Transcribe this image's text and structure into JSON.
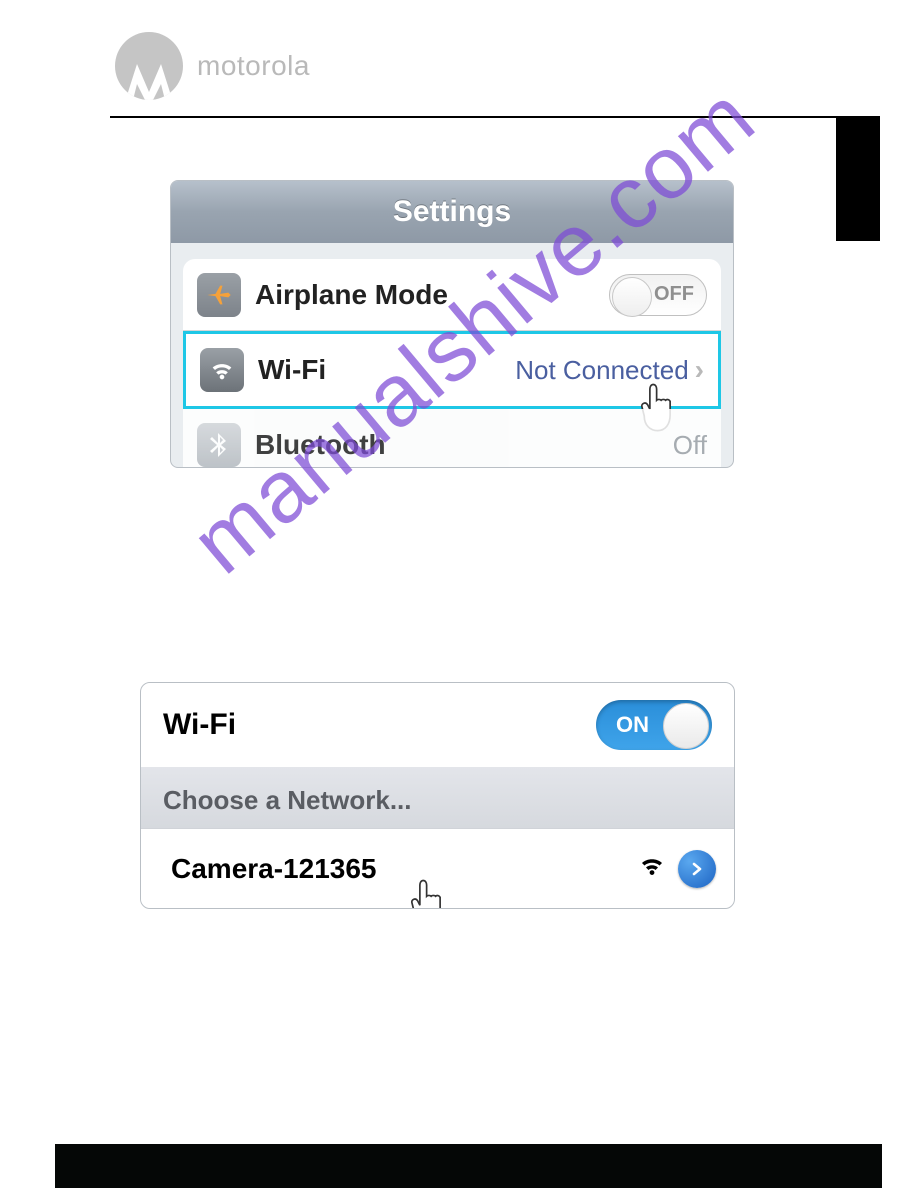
{
  "brand": {
    "name": "motorola"
  },
  "watermark": {
    "text": "manualshive.com"
  },
  "settings": {
    "title": "Settings",
    "rows": {
      "airplane": {
        "label": "Airplane Mode",
        "toggle_text": "OFF"
      },
      "wifi": {
        "label": "Wi-Fi",
        "value": "Not Connected"
      },
      "bluetooth": {
        "label": "Bluetooth",
        "value": "Off"
      }
    }
  },
  "wifi_panel": {
    "header_label": "Wi-Fi",
    "toggle_text": "ON",
    "choose_label": "Choose a Network...",
    "network": {
      "name": "Camera-121365"
    }
  }
}
